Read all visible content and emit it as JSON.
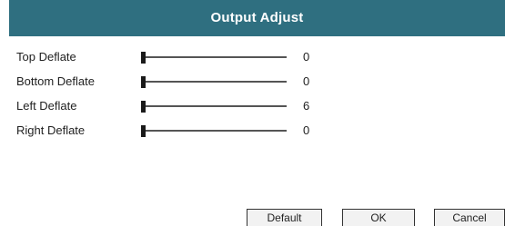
{
  "dialog": {
    "title": "Output Adjust"
  },
  "settings": [
    {
      "label": "Top Deflate",
      "value": "0",
      "level": 0
    },
    {
      "label": "Bottom Deflate",
      "value": "0",
      "level": 0
    },
    {
      "label": "Left Deflate",
      "value": "6",
      "level": 0.06
    },
    {
      "label": "Right Deflate",
      "value": "0",
      "level": 0
    }
  ],
  "buttons": {
    "default_label": "Default",
    "ok_label": "OK",
    "cancel_label": "Cancel"
  },
  "colors": {
    "title_bar": "#2f6f80",
    "title_text": "#ffffff"
  }
}
